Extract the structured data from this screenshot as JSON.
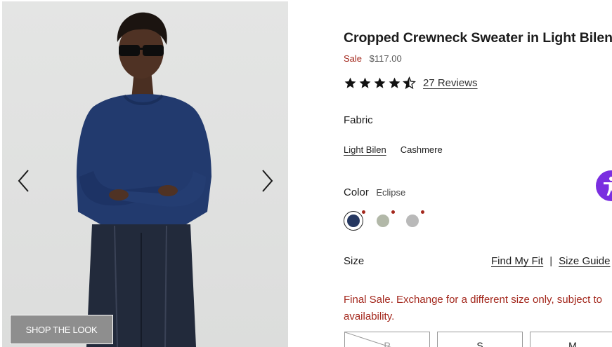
{
  "gallery": {
    "prev_icon": "chevron-left-icon",
    "next_icon": "chevron-right-icon",
    "shop_the_look": "SHOP THE LOOK"
  },
  "product": {
    "title": "Cropped Crewneck Sweater in Light Bilen",
    "sale_label": "Sale",
    "price": "$117.00",
    "rating": 4.5,
    "reviews": "27 Reviews"
  },
  "fabric": {
    "label": "Fabric",
    "options": [
      "Light Bilen",
      "Cashmere"
    ],
    "selected": "Light Bilen"
  },
  "color": {
    "label": "Color",
    "value": "Eclipse",
    "swatches": [
      {
        "name": "Eclipse",
        "hex": "#253760",
        "selected": true
      },
      {
        "name": "sage",
        "hex": "#b2b8a8",
        "selected": false
      },
      {
        "name": "grey",
        "hex": "#b9b9b9",
        "selected": false
      }
    ],
    "sale_dot_color": "#a3271c"
  },
  "size": {
    "label": "Size",
    "find_fit": "Find My Fit",
    "separator": "|",
    "size_guide": "Size Guide",
    "final_sale": "Final Sale. Exchange for a different size only, subject to availability.",
    "options": [
      {
        "label": "P",
        "available": false
      },
      {
        "label": "S",
        "available": true
      },
      {
        "label": "M",
        "available": true
      }
    ]
  },
  "accessibility": {
    "icon": "accessibility-icon"
  },
  "colors": {
    "accent": "#a3271c",
    "accessibility": "#7a2ee0"
  }
}
